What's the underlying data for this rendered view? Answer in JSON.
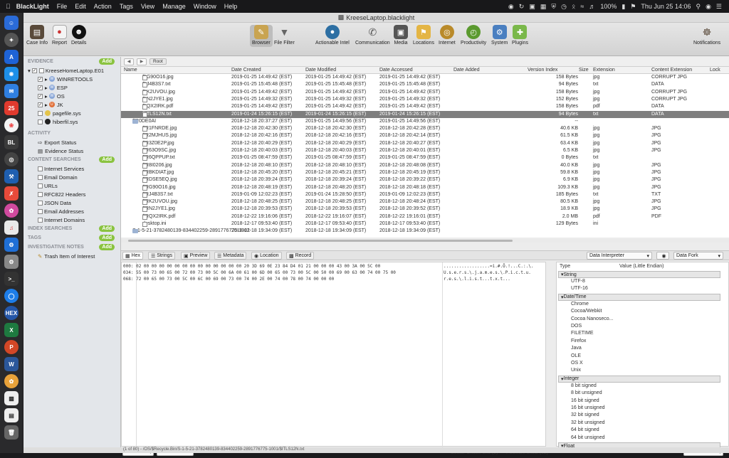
{
  "menubar": {
    "app": "BlackLight",
    "items": [
      "File",
      "Edit",
      "Action",
      "Tags",
      "View",
      "Manage",
      "Window",
      "Help"
    ],
    "battery": "100%",
    "clock": "Thu Jun 25  14:06"
  },
  "window": {
    "title": "KreeseLaptop.blacklight"
  },
  "toolbar": {
    "case_info": "Case Info",
    "report": "Report",
    "details": "Details",
    "browser": "Browser",
    "file_filter": "File Filter",
    "actionable": "Actionable Intel",
    "communication": "Communication",
    "media": "Media",
    "locations": "Locations",
    "internet": "Internet",
    "productivity": "Productivity",
    "system": "System",
    "plugins": "Plugins",
    "notifications": "Notifications"
  },
  "sidebar": {
    "evidence_header": "EVIDENCE",
    "add": "Add",
    "evidence_items": [
      "KreeseHomeLaptop.E01",
      "WINRETOOLS",
      "ESP",
      "OS",
      "JK",
      "pagefile.sys",
      "hiberfil.sys"
    ],
    "activity_header": "ACTIVITY",
    "activity_items": [
      "Export Status",
      "Evidence Status"
    ],
    "content_header": "CONTENT SEARCHES",
    "content_items": [
      "Internet Services",
      "Email Domain",
      "URLs",
      "RFC822 Headers",
      "JSON Data",
      "Email Addresses",
      "Internet Domains"
    ],
    "index_header": "INDEX SEARCHES",
    "tags_header": "TAGS",
    "notes_header": "INVESTIGATIVE NOTES",
    "notes_items": [
      "Trash Item of Interest"
    ]
  },
  "pathbar": {
    "root": "Root"
  },
  "columns": [
    "Name",
    "Date Created",
    "Date Modified",
    "Date Accessed",
    "Date Added",
    "Version Index",
    "Size",
    "Extension",
    "Content Extension",
    "Lock"
  ],
  "rows": [
    [
      "$IG90O16.jpg",
      "2019-01-25 14:49:42 (EST)",
      "2019-01-25 14:49:42 (EST)",
      "2019-01-25 14:49:42 (EST)",
      "158 Bytes",
      "jpg",
      "CORRUPT JPG"
    ],
    [
      "$IJ4B3S7.txt",
      "2019-01-25 15:45:48 (EST)",
      "2019-01-25 15:45:48 (EST)",
      "2019-01-25 15:45:48 (EST)",
      "94 Bytes",
      "txt",
      "DATA"
    ],
    [
      "$IK2UVOU.jpg",
      "2019-01-25 14:49:42 (EST)",
      "2019-01-25 14:49:42 (EST)",
      "2019-01-25 14:49:42 (EST)",
      "158 Bytes",
      "jpg",
      "CORRUPT JPG"
    ],
    [
      "$IN2JYE1.jpg",
      "2019-01-25 14:49:32 (EST)",
      "2019-01-25 14:49:32 (EST)",
      "2019-01-25 14:49:32 (EST)",
      "152 Bytes",
      "jpg",
      "CORRUPT JPG"
    ],
    [
      "$IQX2IRK.pdf",
      "2019-01-25 14:49:42 (EST)",
      "2019-01-25 14:49:42 (EST)",
      "2019-01-25 14:49:42 (EST)",
      "158 Bytes",
      "pdf",
      "DATA"
    ],
    [
      "$ITLS12N.txt",
      "2019-01-24 15:26:15 (EST)",
      "2019-01-24 15:26:15 (EST)",
      "2019-01-24 15:26:15 (EST)",
      "94 Bytes",
      "txt",
      "DATA"
    ],
    [
      "$R0DE0AI",
      "2018-12-18 20:37:27 (EST)",
      "2019-01-25 14:49:56 (EST)",
      "2019-01-25 14:49:56 (EST)",
      "--",
      "",
      ""
    ],
    [
      "$R1FNRDE.jpg",
      "2018-12-18 20:42:30 (EST)",
      "2018-12-18 20:42:30 (EST)",
      "2018-12-18 20:42:28 (EST)",
      "40.6 KB",
      "jpg",
      "JPG"
    ],
    [
      "$R2MJHUS.jpg",
      "2018-12-18 20:42:16 (EST)",
      "2018-12-18 20:42:16 (EST)",
      "2018-12-18 20:42:14 (EST)",
      "61.5 KB",
      "jpg",
      "JPG"
    ],
    [
      "$R3Z0E2P.jpg",
      "2018-12-18 20:40:29 (EST)",
      "2018-12-18 20:40:29 (EST)",
      "2018-12-18 20:40:27 (EST)",
      "63.4 KB",
      "jpg",
      "JPG"
    ],
    [
      "$R63O9SC.jpg",
      "2018-12-18 20:40:03 (EST)",
      "2018-12-18 20:40:03 (EST)",
      "2018-12-18 20:40:01 (EST)",
      "6.5 KB",
      "jpg",
      "JPG"
    ],
    [
      "$R6QPPUP.txt",
      "2019-01-25 08:47:59 (EST)",
      "2019-01-25 08:47:59 (EST)",
      "2019-01-25 08:47:59 (EST)",
      "0 Bytes",
      "txt",
      ""
    ],
    [
      "$R8I0206.jpg",
      "2018-12-18 20:48:10 (EST)",
      "2018-12-18 20:48:10 (EST)",
      "2018-12-18 20:48:08 (EST)",
      "40.0 KB",
      "jpg",
      "JPG"
    ],
    [
      "$RBKDIAT.jpg",
      "2018-12-18 20:45:20 (EST)",
      "2018-12-18 20:45:21 (EST)",
      "2018-12-18 20:45:19 (EST)",
      "59.8 KB",
      "jpg",
      "JPG"
    ],
    [
      "$RDSE5EQ.jpg",
      "2018-12-18 20:39:24 (EST)",
      "2018-12-18 20:39:24 (EST)",
      "2018-12-18 20:39:22 (EST)",
      "6.9 KB",
      "jpg",
      "JPG"
    ],
    [
      "$RG90O16.jpg",
      "2018-12-18 20:48:19 (EST)",
      "2018-12-18 20:48:20 (EST)",
      "2018-12-18 20:48:18 (EST)",
      "109.3 KB",
      "jpg",
      "JPG"
    ],
    [
      "$RJ4B3S7.txt",
      "2019-01-09 12:02:23 (EST)",
      "2019-01-24 15:28:50 (EST)",
      "2019-01-09 12:02:23 (EST)",
      "185 Bytes",
      "txt",
      "TXT"
    ],
    [
      "$RK2UVOU.jpg",
      "2018-12-18 20:48:25 (EST)",
      "2018-12-18 20:48:25 (EST)",
      "2018-12-18 20:48:24 (EST)",
      "80.5 KB",
      "jpg",
      "JPG"
    ],
    [
      "$RN2JYE1.jpg",
      "2018-12-18 20:39:53 (EST)",
      "2018-12-18 20:39:53 (EST)",
      "2018-12-18 20:39:52 (EST)",
      "18.9 KB",
      "jpg",
      "JPG"
    ],
    [
      "$RQX2IRK.pdf",
      "2018-12-22 19:16:06 (EST)",
      "2018-12-22 19:16:07 (EST)",
      "2018-12-22 19:16:01 (EST)",
      "2.0 MB",
      "pdf",
      "PDF"
    ],
    [
      "desktop.ini",
      "2018-12-17 09:53:40 (EST)",
      "2018-12-17 09:53:40 (EST)",
      "2018-12-17 09:53:40 (EST)",
      "129 Bytes",
      "ini",
      ""
    ],
    [
      "S-1-5-21-3782480139-834402259-2891776775-1001",
      "2018-12-18 19:34:09 (EST)",
      "2018-12-18 19:34:09 (EST)",
      "2018-12-18 19:34:09 (EST)",
      "",
      "",
      ""
    ]
  ],
  "tabs": [
    "Hex",
    "Strings",
    "Preview",
    "Metadata",
    "Location",
    "Record"
  ],
  "interp_selects": {
    "mode": "Data Interpreter",
    "fork": "Data Fork"
  },
  "hex": {
    "offsets": [
      "000:",
      "034:",
      "068:"
    ],
    "bytes": [
      "02 00 00 00 00 00 00 00 00 00 00 00 00 00 20 3D 69 0E 23 84 D4 01 21 00 00 00 43 00 3A 00 5C 00",
      "55 00 73 00 65 00 72 00 73 00 5C 00 6A 00 61 00 6D 00 65 00 73 00 5C 00 50 00 69 00 63 00 74 00 75 00",
      "72 00 65 00 73 00 5C 00 6C 00 69 00 73 00 74 00 2E 00 74 00 78 00 74 00 00 00"
    ],
    "ascii": [
      "..................=i.#.Ô.!...C.:.\\.",
      "U.s.e.r.s.\\.j.a.m.e.s.\\.P.i.c.t.u.",
      "r.e.s.\\.l.i.s.t...t.x.t..."
    ]
  },
  "interp": {
    "type_col": "Type",
    "value_col": "Value (Little Endian)",
    "groups": [
      {
        "name": "String",
        "items": [
          "UTF-8",
          "UTF-16"
        ]
      },
      {
        "name": "Date/Time",
        "items": [
          "Chrome",
          "Cocoa/Webkit",
          "Cocoa Nanoseco...",
          "DOS",
          "FILETIME",
          "Firefox",
          "Java",
          "OLE",
          "OS X",
          "Unix"
        ]
      },
      {
        "name": "Integer",
        "items": [
          "8 bit signed",
          "8 bit unsigned",
          "16 bit signed",
          "16 bit unsigned",
          "32 bit signed",
          "32 bit unsigned",
          "64 bit signed",
          "64 bit unsigned"
        ]
      },
      {
        "name": "Float",
        "items": []
      }
    ]
  },
  "status": {
    "format": "Decimal",
    "goto": "Go To Position",
    "sector": "Sector Offset: 0x0 (0)",
    "position": "Position: 0x3E (62)",
    "endian": "Little Endian"
  },
  "footer": {
    "count": "(1 of 80)",
    "path": "- /OS/$Recycle.Bin/S-1-5-21-3782480139-834402259-2891776775-1001/$ITLS12N.txt"
  }
}
